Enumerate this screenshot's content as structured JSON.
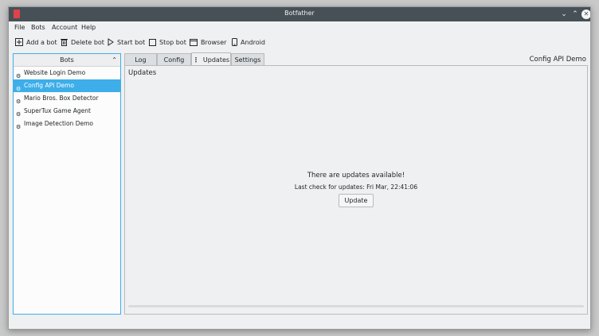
{
  "window": {
    "title": "Botfather"
  },
  "menu": [
    "File",
    "Bots",
    "Account",
    "Help"
  ],
  "toolbar": {
    "add": "Add a bot",
    "delete": "Delete bot",
    "start": "Start bot",
    "stop": "Stop bot",
    "browser": "Browser",
    "android": "Android"
  },
  "bots": {
    "header": "Bots",
    "items": [
      {
        "label": "Website Login Demo"
      },
      {
        "label": "Config API Demo",
        "selected": true
      },
      {
        "label": "Mario Bros. Box Detector"
      },
      {
        "label": "SuperTux Game Agent"
      },
      {
        "label": "Image Detection Demo"
      }
    ]
  },
  "tabs": [
    "Log",
    "Config",
    "Updates",
    "Settings"
  ],
  "active_tab": "Updates",
  "selected_bot_label": "Config API Demo",
  "updates": {
    "title": "Updates",
    "message": "There are updates available!",
    "last_check": "Last check for updates:  Fri Mar, 22:41:06",
    "button": "Update"
  },
  "colors": {
    "accent": "#3daee9",
    "titlebar": "#475057"
  }
}
